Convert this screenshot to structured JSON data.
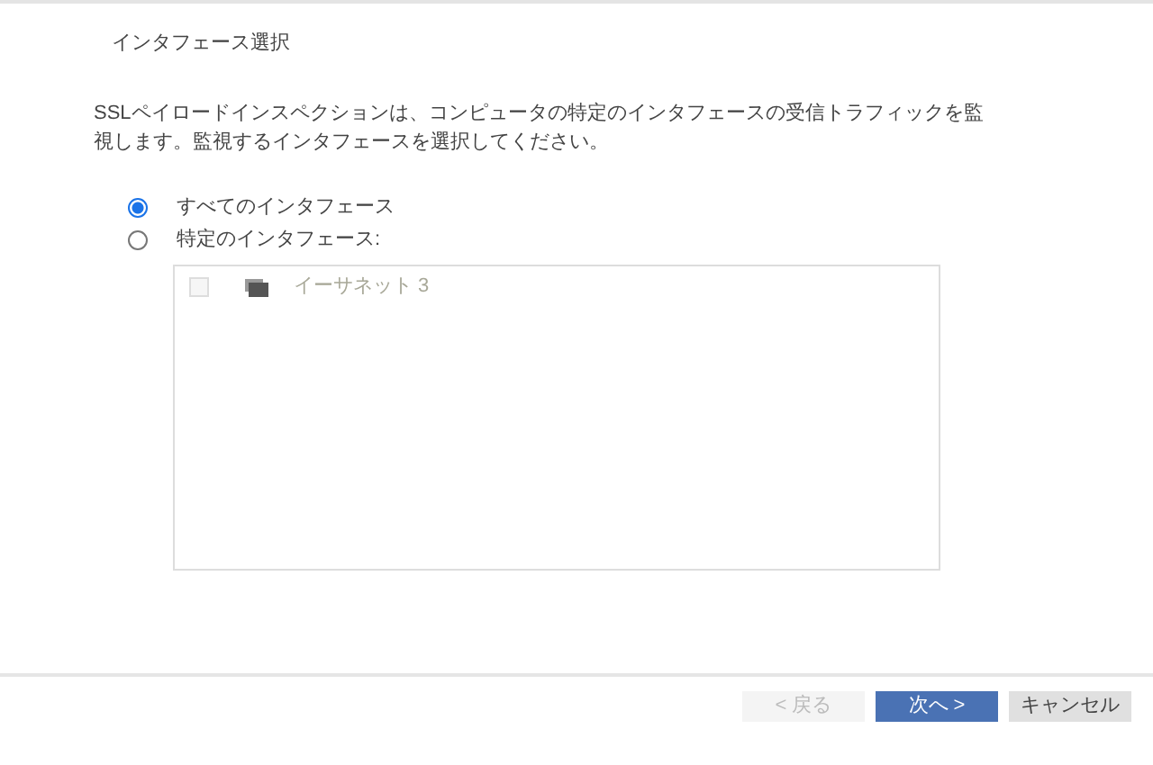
{
  "title": "インタフェース選択",
  "description": "SSLペイロードインスペクションは、コンピュータの特定のインタフェースの受信トラフィックを監視します。監視するインタフェースを選択してください。",
  "options": [
    {
      "label": "すべてのインタフェース",
      "selected": true
    },
    {
      "label": "特定のインタフェース:",
      "selected": false
    }
  ],
  "interfaces": [
    {
      "label": "イーサネット 3",
      "checked": false,
      "disabled": true
    }
  ],
  "buttons": [
    {
      "label": "< 戻る",
      "kind": "secondary",
      "disabled": true
    },
    {
      "label": "次へ >",
      "kind": "primary",
      "disabled": false
    },
    {
      "label": "キャンセル",
      "kind": "secondary",
      "disabled": false
    }
  ]
}
